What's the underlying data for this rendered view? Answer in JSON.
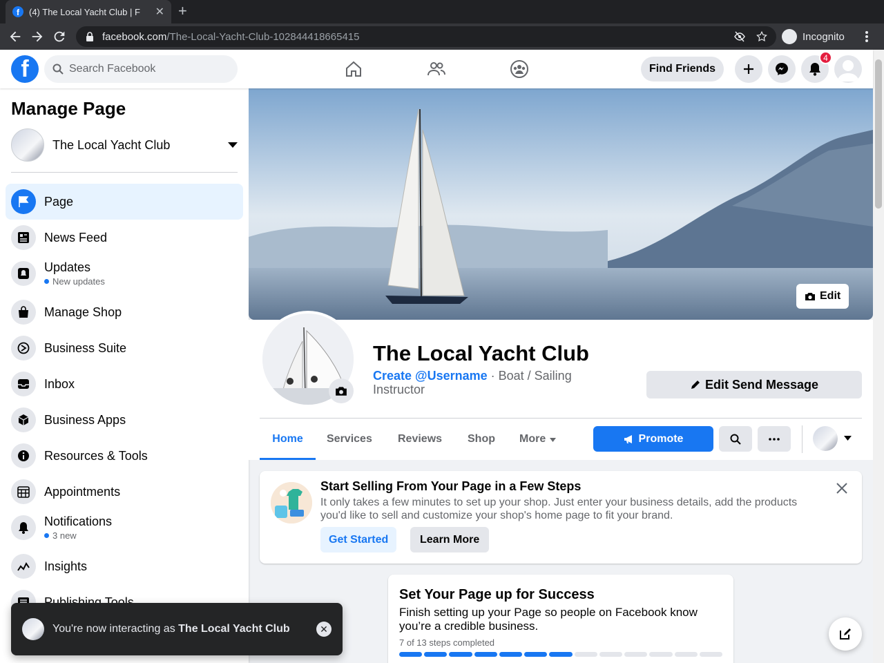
{
  "browser": {
    "tab_title": "(4) The Local Yacht Club | F",
    "url_domain": "facebook.com",
    "url_path": "/The-Local-Yacht-Club-102844418665415",
    "incognito_label": "Incognito"
  },
  "nav": {
    "logo": "f",
    "search_placeholder": "Search Facebook",
    "find_friends": "Find Friends",
    "notification_count": "4"
  },
  "sidebar": {
    "title": "Manage Page",
    "page_name": "The Local Yacht Club",
    "items": [
      {
        "label": "Page",
        "icon": "flag-icon",
        "active": true
      },
      {
        "label": "News Feed",
        "icon": "newsfeed-icon"
      },
      {
        "label": "Updates",
        "icon": "updates-icon",
        "sub": "New updates"
      },
      {
        "label": "Manage Shop",
        "icon": "shop-bag-icon"
      },
      {
        "label": "Business Suite",
        "icon": "business-suite-icon"
      },
      {
        "label": "Inbox",
        "icon": "inbox-icon"
      },
      {
        "label": "Business Apps",
        "icon": "cube-icon"
      },
      {
        "label": "Resources & Tools",
        "icon": "info-icon"
      },
      {
        "label": "Appointments",
        "icon": "calendar-icon"
      },
      {
        "label": "Notifications",
        "icon": "bell-icon",
        "sub": "3 new"
      },
      {
        "label": "Insights",
        "icon": "insights-icon"
      },
      {
        "label": "Publishing Tools",
        "icon": "publishing-icon"
      }
    ]
  },
  "toast": {
    "prefix": "You're now interacting as ",
    "name": "The Local Yacht Club"
  },
  "cover": {
    "edit_label": "Edit"
  },
  "profile": {
    "name": "The Local Yacht Club",
    "username_link": "Create @Username",
    "category": " · Boat / Sailing Instructor",
    "edit_send_message": "Edit Send Message"
  },
  "tabs": [
    "Home",
    "Services",
    "Reviews",
    "Shop",
    "More"
  ],
  "promote_label": "Promote",
  "shop_card": {
    "title": "Start Selling From Your Page in a Few Steps",
    "description": "It only takes a few minutes to set up your shop. Just enter your business details, add the products you'd like to sell and customize your shop's home page to fit your brand.",
    "get_started": "Get Started",
    "learn_more": "Learn More"
  },
  "setup_card": {
    "title": "Set Your Page up for Success",
    "description": "Finish setting up your Page so people on Facebook know you’re a credible business.",
    "progress_text": "7 of 13 steps completed",
    "steps_completed": 7,
    "steps_total": 13
  },
  "colors": {
    "brand": "#1877f2",
    "badge": "#e41e3f"
  }
}
